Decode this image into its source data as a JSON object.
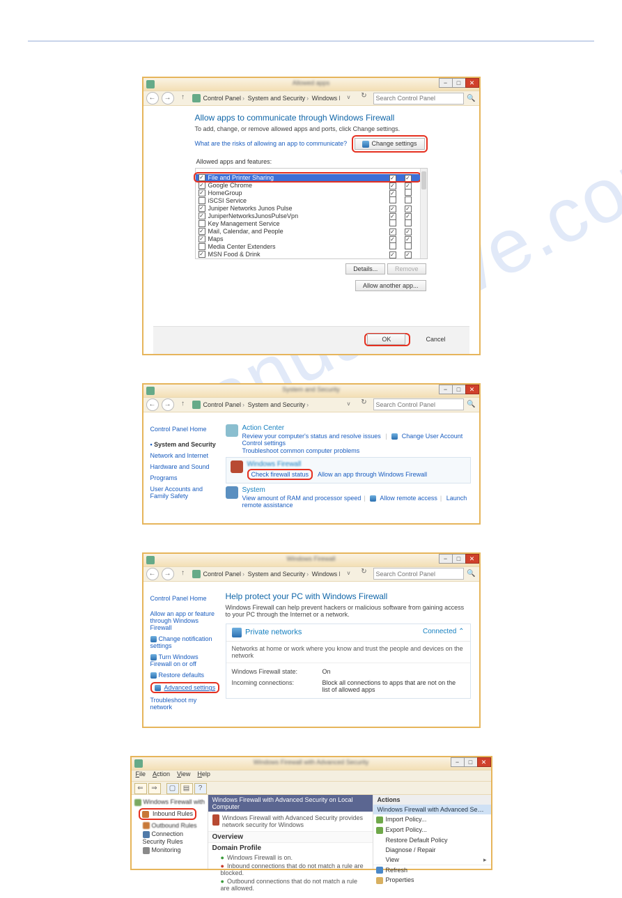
{
  "watermark": "manualhlive.com",
  "win_buttons": {
    "min": "−",
    "max": "□",
    "close": "✕"
  },
  "search_placeholder": "Search Control Panel",
  "nav": {
    "back": "←",
    "fwd": "→",
    "up": "↑",
    "refresh": "↻"
  },
  "shot1": {
    "title_blur": "Allowed apps",
    "breadcrumb": [
      "Control Panel",
      "System and Security",
      "Windows Firewall",
      "Allowed apps"
    ],
    "heading": "Allow apps to communicate through Windows Firewall",
    "subtext": "To add, change, or remove allowed apps and ports, click Change settings.",
    "risks_link": "What are the risks of allowing an app to communicate?",
    "change_settings": "Change settings",
    "feat_label": "Allowed apps and features:",
    "items": [
      {
        "name": "File and Printer Sharing",
        "on": true,
        "p": true,
        "u": true,
        "sel": true
      },
      {
        "name": "Google Chrome",
        "on": true,
        "p": true,
        "u": true
      },
      {
        "name": "HomeGroup",
        "on": true,
        "p": true,
        "u": false
      },
      {
        "name": "iSCSI Service",
        "on": false,
        "p": false,
        "u": false
      },
      {
        "name": "Juniper Networks Junos Pulse",
        "on": true,
        "p": true,
        "u": true
      },
      {
        "name": "JuniperNetworksJunosPulseVpn",
        "on": true,
        "p": true,
        "u": true
      },
      {
        "name": "Key Management Service",
        "on": false,
        "p": false,
        "u": false
      },
      {
        "name": "Mail, Calendar, and People",
        "on": true,
        "p": true,
        "u": true
      },
      {
        "name": "Maps",
        "on": true,
        "p": true,
        "u": true
      },
      {
        "name": "Media Center Extenders",
        "on": false,
        "p": false,
        "u": false
      },
      {
        "name": "MSN Food & Drink",
        "on": true,
        "p": true,
        "u": true
      }
    ],
    "details": "Details...",
    "remove": "Remove",
    "allow_another": "Allow another app...",
    "ok": "OK",
    "cancel": "Cancel"
  },
  "shot2": {
    "title_blur": "System and Security",
    "breadcrumb": [
      "Control Panel",
      "System and Security"
    ],
    "side": {
      "home": "Control Panel Home",
      "current": "System and Security",
      "links": [
        "Network and Internet",
        "Hardware and Sound",
        "Programs",
        "User Accounts and Family Safety"
      ]
    },
    "action_center": {
      "name": "Action Center",
      "l1": "Review your computer's status and resolve issues",
      "l2": "Change User Account Control settings",
      "l3": "Troubleshoot common computer problems"
    },
    "firewall": {
      "name": "Windows Firewall",
      "check": "Check firewall status",
      "allow": "Allow an app through Windows Firewall"
    },
    "system": {
      "name": "System",
      "l1": "View amount of RAM and processor speed",
      "l2": "Allow remote access",
      "l3": "Launch remote assistance"
    }
  },
  "shot3": {
    "title_blur": "Windows Firewall",
    "breadcrumb": [
      "Control Panel",
      "System and Security",
      "Windows Firewall"
    ],
    "side": {
      "home": "Control Panel Home",
      "links": [
        "Allow an app or feature through Windows Firewall",
        "Change notification settings",
        "Turn Windows Firewall on or off",
        "Restore defaults",
        "Advanced settings",
        "Troubleshoot my network"
      ]
    },
    "heading": "Help protect your PC with Windows Firewall",
    "sub": "Windows Firewall can help prevent hackers or malicious software from gaining access to your PC through the Internet or a network.",
    "priv": "Private networks",
    "connected": "Connected ⌃",
    "priv_sub": "Networks at home or work where you know and trust the people and devices on the network",
    "state_l": "Windows Firewall state:",
    "state_v": "On",
    "inc_l": "Incoming connections:",
    "inc_v": "Block all connections to apps that are not on the list of allowed apps"
  },
  "shot4": {
    "title_blur": "Windows Firewall with Advanced Security",
    "menus": [
      "File",
      "Action",
      "View",
      "Help"
    ],
    "tree": {
      "root": "Windows Firewall with Advanc",
      "inbound": "Inbound Rules",
      "items": [
        "Outbound Rules",
        "Connection Security Rules",
        "Monitoring"
      ]
    },
    "mid": {
      "hdr": "Windows Firewall with Advanced Security on Local Computer",
      "desc": "Windows Firewall with Advanced Security provides network security for Windows",
      "over": "Overview",
      "domain": "Domain Profile",
      "s1": "Windows Firewall is on.",
      "s2": "Inbound connections that do not match a rule are blocked.",
      "s3": "Outbound connections that do not match a rule are allowed."
    },
    "actions": {
      "hdr": "Actions",
      "sel": "Windows Firewall with Advanced Security on L…",
      "items": [
        "Import Policy...",
        "Export Policy...",
        "Restore Default Policy",
        "Diagnose / Repair",
        "View",
        "Refresh",
        "Properties"
      ]
    }
  }
}
